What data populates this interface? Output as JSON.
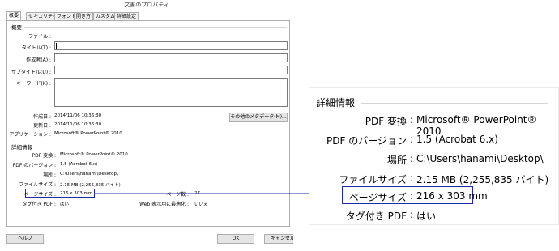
{
  "window": {
    "title": "文書のプロパティ"
  },
  "tabs": [
    "概要",
    "セキュリティ",
    "フォント",
    "開き方",
    "カスタム",
    "詳細設定"
  ],
  "summary": {
    "title": "概要",
    "fields": [
      {
        "label": "ファイル :",
        "value": ""
      },
      {
        "label": "タイトル(T) :",
        "value": ""
      },
      {
        "label": "作成者(A) :",
        "value": ""
      },
      {
        "label": "サブタイトル(U) :",
        "value": ""
      },
      {
        "label": "キーワード(K) :",
        "value": ""
      }
    ],
    "created_label": "作成日 :",
    "created": "2014/11/06 10:36:30",
    "modified_label": "更新日 :",
    "modified": "2014/11/06 10:36:30",
    "app_label": "アプリケーション :",
    "app": "Microsoft® PowerPoint® 2010",
    "metadata_button": "その他のメタデータ(M)..."
  },
  "details": {
    "title": "詳細情報",
    "rows": [
      {
        "label": "PDF 変換 :",
        "value": "Microsoft® PowerPoint® 2010"
      },
      {
        "label": "PDF のバージョン :",
        "value": "1.5 (Acrobat 6.x)"
      },
      {
        "label": "場所 :",
        "value": "C:\\Users\\hanami\\Desktop\\"
      },
      {
        "label": "ファイルサイズ :",
        "value": "2.15 MB (2,255,835 バイト)"
      },
      {
        "label": "ページサイズ :",
        "value": "216 x 303 mm"
      },
      {
        "label": "タグ付き PDF :",
        "value": "はい"
      }
    ],
    "page_count_label": "ページ数 :",
    "page_count": "27",
    "web_label": "Web 表示用に最適化 :",
    "web_value": "いいえ"
  },
  "buttons": {
    "help": "ヘルプ",
    "ok": "OK",
    "cancel": "キャンセル"
  },
  "zoom": {
    "title": "詳細情報",
    "rows": [
      {
        "label": "PDF 変換",
        "value": "Microsoft® PowerPoint® 2010"
      },
      {
        "label": "PDF のバージョン",
        "value": "1.5 (Acrobat 6.x)"
      },
      {
        "label": "場所",
        "value": "C:\\Users\\hanami\\Desktop\\"
      },
      {
        "label": "ファイルサイズ",
        "value": "2.15 MB (2,255,835 バイト)"
      },
      {
        "label": "ページサイズ",
        "value": "216 x 303 mm"
      },
      {
        "label": "タグ付き PDF",
        "value": "はい"
      }
    ],
    "separator": ":"
  },
  "colors": {
    "highlight": "#1f2aa8"
  }
}
